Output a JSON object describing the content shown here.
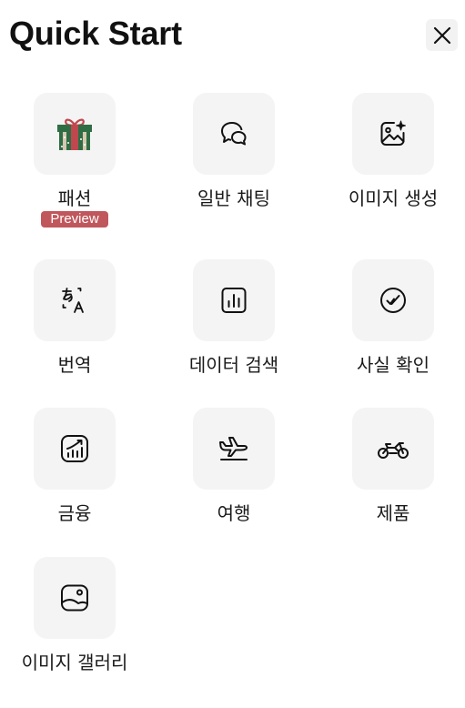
{
  "header": {
    "title": "Quick Start"
  },
  "items": [
    {
      "label": "패션",
      "badge": "Preview",
      "icon": "gift-icon"
    },
    {
      "label": "일반 채팅",
      "icon": "chat-bubbles-icon"
    },
    {
      "label": "이미지 생성",
      "icon": "image-sparkle-icon"
    },
    {
      "label": "번역",
      "icon": "translate-icon"
    },
    {
      "label": "데이터 검색",
      "icon": "bar-chart-icon"
    },
    {
      "label": "사실 확인",
      "icon": "check-circle-icon"
    },
    {
      "label": "금융",
      "icon": "finance-chart-icon"
    },
    {
      "label": "여행",
      "icon": "airplane-icon"
    },
    {
      "label": "제품",
      "icon": "motorcycle-icon"
    },
    {
      "label": "이미지 갤러리",
      "icon": "gallery-icon"
    }
  ],
  "colors": {
    "badge": "#c0575c",
    "tile": "#f4f4f4",
    "close_bg": "#f2f2f2"
  }
}
